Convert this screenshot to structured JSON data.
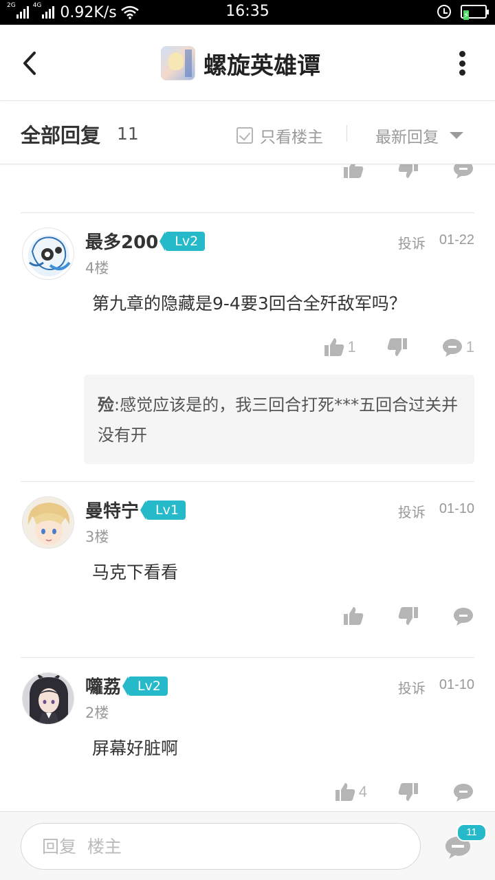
{
  "status_bar": {
    "net_left": "2G",
    "net_right": "4G",
    "speed": "0.92K/s",
    "time": "16:35",
    "battery": "⚡"
  },
  "header": {
    "title": "螺旋英雄谭",
    "icons": {
      "back": "back-chevron-icon",
      "more": "more-vertical-icon"
    }
  },
  "filter": {
    "title": "全部回复",
    "count": "11",
    "only_op_label": "只看楼主",
    "only_op_checked": false,
    "sort_label": "最新回复"
  },
  "comments": [
    {
      "user": "最多200",
      "level": "Lv2",
      "floor": "4楼",
      "report": "投诉",
      "date": "01-22",
      "text": "第九章的隐藏是9-4要3回合全歼敌军吗？",
      "likes": "1",
      "replies": "1",
      "reply": {
        "user": "殓",
        "sep": ":",
        "text": "感觉应该是的，我三回合打死***五回合过关并没有开"
      }
    },
    {
      "user": "曼特宁",
      "level": "Lv1",
      "floor": "3楼",
      "report": "投诉",
      "date": "01-10",
      "text": "马克下看看"
    },
    {
      "user": "囖荔",
      "level": "Lv2",
      "floor": "2楼",
      "report": "投诉",
      "date": "01-10",
      "text": "屏幕好脏啊",
      "likes": "4"
    }
  ],
  "bottom": {
    "placeholder": "回复  楼主",
    "badge": "11"
  },
  "colors": {
    "accent": "#25b9c9",
    "icon_gray": "#b5b5b5",
    "text_dark": "#333333",
    "text_gray": "#999999"
  }
}
